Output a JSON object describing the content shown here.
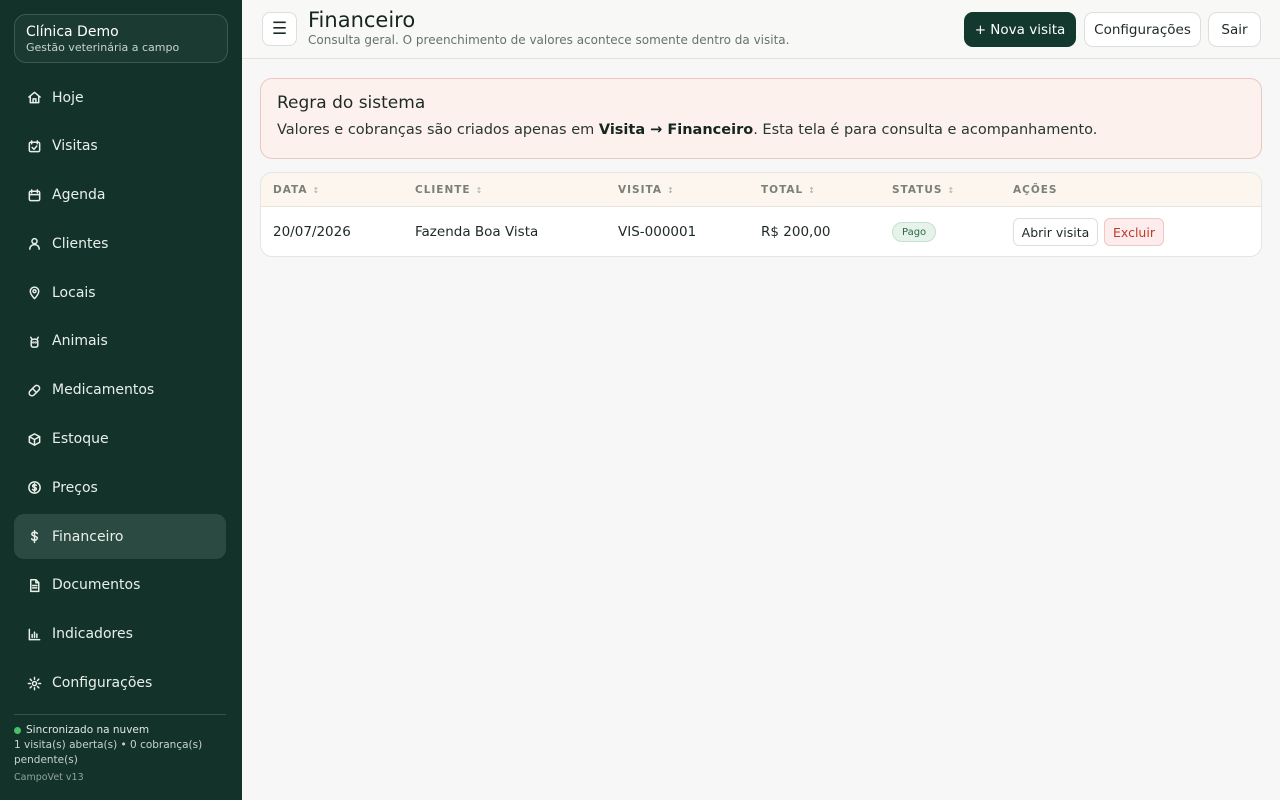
{
  "sidebar": {
    "brand_title": "Clínica Demo",
    "brand_subtitle": "Gestão veterinária a campo",
    "items": [
      {
        "label": "Hoje",
        "icon": "home-icon"
      },
      {
        "label": "Visitas",
        "icon": "calendar-check-icon"
      },
      {
        "label": "Agenda",
        "icon": "calendar-icon"
      },
      {
        "label": "Clientes",
        "icon": "user-icon"
      },
      {
        "label": "Locais",
        "icon": "map-pin-icon"
      },
      {
        "label": "Animais",
        "icon": "animal-icon"
      },
      {
        "label": "Medicamentos",
        "icon": "pill-icon"
      },
      {
        "label": "Estoque",
        "icon": "box-icon"
      },
      {
        "label": "Preços",
        "icon": "price-icon"
      },
      {
        "label": "Financeiro",
        "icon": "dollar-icon",
        "active": true
      },
      {
        "label": "Documentos",
        "icon": "document-icon"
      },
      {
        "label": "Indicadores",
        "icon": "bar-chart-icon"
      },
      {
        "label": "Configurações",
        "icon": "gear-icon"
      }
    ],
    "sync_status": "Sincronizado na nuvem",
    "sync_summary": "1 visita(s) aberta(s) • 0 cobrança(s) pendente(s)",
    "version": "CampoVet v13"
  },
  "header": {
    "menu_icon": "☰",
    "title": "Financeiro",
    "subtitle": "Consulta geral. O preenchimento de valores acontece somente dentro da visita.",
    "new_visit_label": "+ Nova visita",
    "settings_label": "Configurações",
    "logout_label": "Sair"
  },
  "alert": {
    "title": "Regra do sistema",
    "text_before": "Valores e cobranças são criados apenas em ",
    "text_bold": "Visita → Financeiro",
    "text_after": ". Esta tela é para consulta e acompanhamento."
  },
  "table": {
    "columns": [
      "DATA",
      "CLIENTE",
      "VISITA",
      "TOTAL",
      "STATUS",
      "AÇÕES"
    ],
    "sort_glyph": "↕",
    "rows": [
      {
        "data": "20/07/2026",
        "cliente": "Fazenda Boa Vista",
        "visita": "VIS-000001",
        "total": "R$ 200,00",
        "status": "Pago",
        "open_label": "Abrir visita",
        "delete_label": "Excluir"
      }
    ]
  },
  "colors": {
    "sidebar_bg": "#13322a",
    "primary": "#13382d",
    "status_ok": "#45c16b",
    "danger": "#c0392b"
  }
}
